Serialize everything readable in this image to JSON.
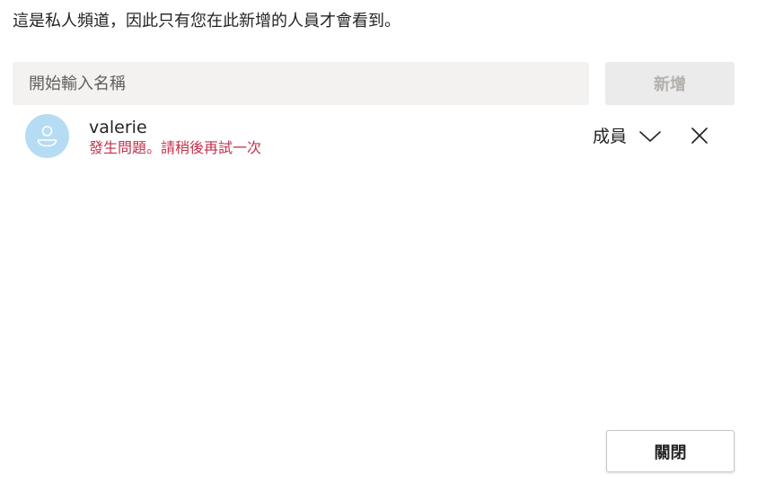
{
  "dialog": {
    "info_text": "這是私人頻道，因此只有您在此新增的人員才會看到。",
    "search": {
      "placeholder": "開始輸入名稱",
      "value": ""
    },
    "add_button_label": "新增",
    "members": [
      {
        "name": "valerie",
        "error": "發生問題。請稍後再試一次",
        "role": "成員",
        "avatar_icon": "person-icon",
        "avatar_color": "#b5dcf3"
      }
    ],
    "close_button_label": "關閉"
  },
  "colors": {
    "error": "#c4314b",
    "input_bg": "#f3f2f1",
    "disabled_bg": "#ebebeb",
    "disabled_text": "#b3b0ad"
  },
  "icons": {
    "role_dropdown": "chevron-down-icon",
    "remove_member": "close-icon"
  }
}
